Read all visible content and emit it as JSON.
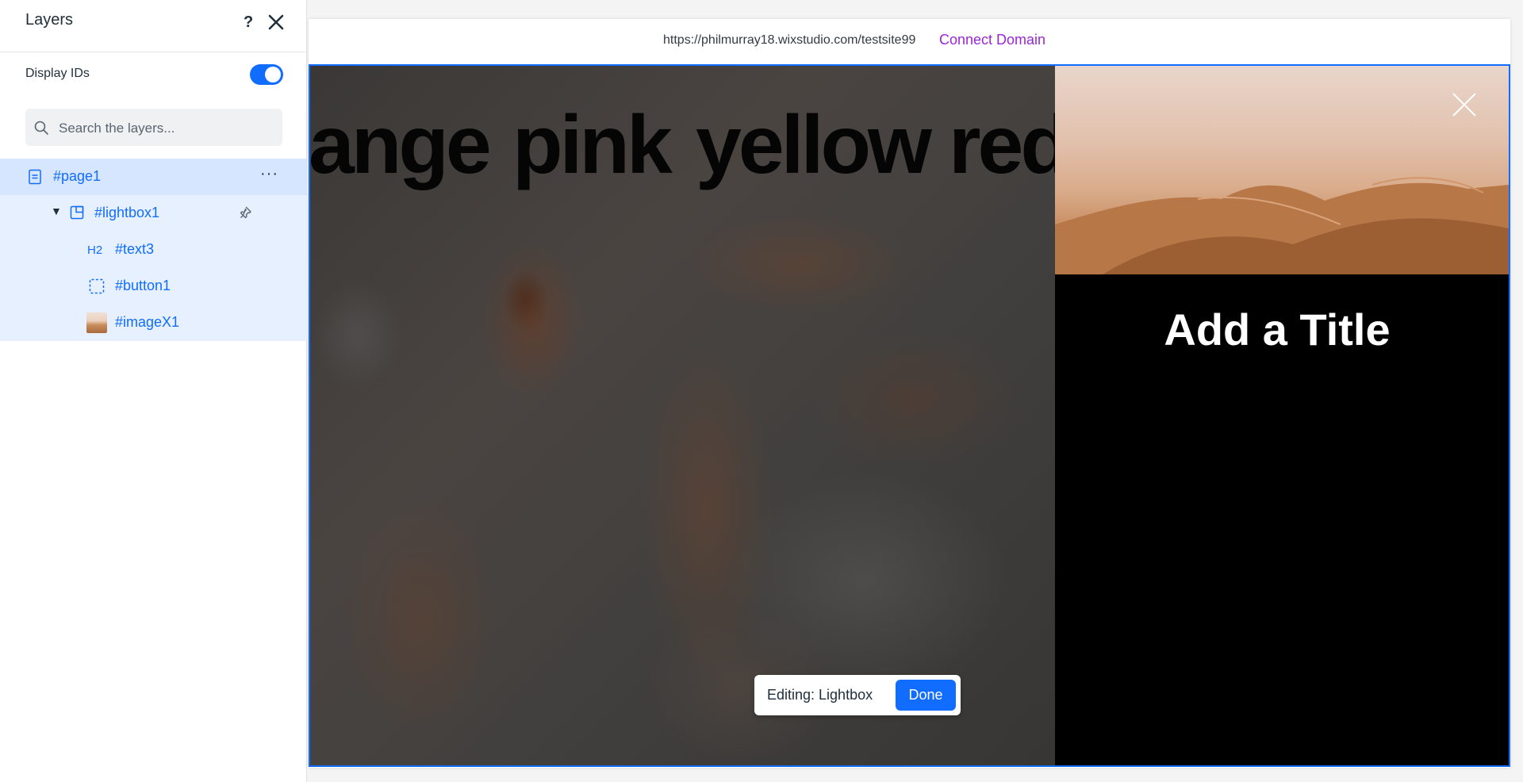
{
  "layers_panel": {
    "title": "Layers",
    "help_label": "?",
    "display_ids": {
      "label": "Display IDs",
      "enabled": true
    },
    "search": {
      "placeholder": "Search the layers...",
      "value": ""
    },
    "tree": [
      {
        "id": "#page1",
        "icon": "page-icon",
        "selected": true,
        "more_label": "···"
      },
      {
        "id": "#lightbox1",
        "icon": "lightbox-icon",
        "expanded": true,
        "caret": "▼",
        "pinned": true
      },
      {
        "id": "#text3",
        "icon": "heading-icon",
        "icon_label": "H2"
      },
      {
        "id": "#button1",
        "icon": "button-icon"
      },
      {
        "id": "#imageX1",
        "icon": "image-thumbnail-icon"
      }
    ]
  },
  "browser": {
    "url": "https://philmurray18.wixstudio.com/testsite99",
    "connect_label": "Connect Domain"
  },
  "canvas": {
    "marquee_words": [
      "ange",
      "pink",
      "yellow",
      "red"
    ],
    "lightbox": {
      "title": "Add a Title"
    }
  },
  "edit_bar": {
    "label": "Editing: Lightbox",
    "done_label": "Done"
  },
  "colors": {
    "accent": "#116dff",
    "link_purple": "#9a27d5",
    "selection": "#d6e6fe"
  }
}
